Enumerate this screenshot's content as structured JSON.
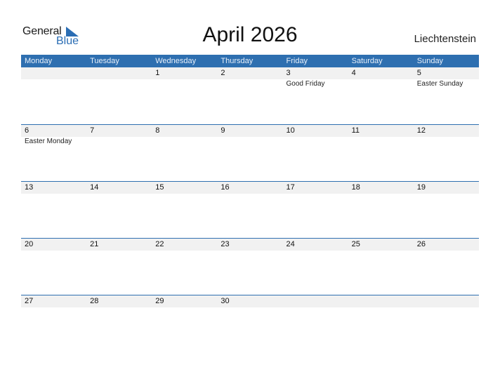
{
  "logo": {
    "general": "General",
    "blue": "Blue"
  },
  "title": "April 2026",
  "country": "Liechtenstein",
  "colors": {
    "accent": "#2e6fb0",
    "strip": "#f1f1f1"
  },
  "weekdays": [
    "Monday",
    "Tuesday",
    "Wednesday",
    "Thursday",
    "Friday",
    "Saturday",
    "Sunday"
  ],
  "weeks": [
    [
      {
        "d": ""
      },
      {
        "d": ""
      },
      {
        "d": "1"
      },
      {
        "d": "2"
      },
      {
        "d": "3",
        "h": "Good Friday"
      },
      {
        "d": "4"
      },
      {
        "d": "5",
        "h": "Easter Sunday"
      }
    ],
    [
      {
        "d": "6",
        "h": "Easter Monday"
      },
      {
        "d": "7"
      },
      {
        "d": "8"
      },
      {
        "d": "9"
      },
      {
        "d": "10"
      },
      {
        "d": "11"
      },
      {
        "d": "12"
      }
    ],
    [
      {
        "d": "13"
      },
      {
        "d": "14"
      },
      {
        "d": "15"
      },
      {
        "d": "16"
      },
      {
        "d": "17"
      },
      {
        "d": "18"
      },
      {
        "d": "19"
      }
    ],
    [
      {
        "d": "20"
      },
      {
        "d": "21"
      },
      {
        "d": "22"
      },
      {
        "d": "23"
      },
      {
        "d": "24"
      },
      {
        "d": "25"
      },
      {
        "d": "26"
      }
    ],
    [
      {
        "d": "27"
      },
      {
        "d": "28"
      },
      {
        "d": "29"
      },
      {
        "d": "30"
      },
      {
        "d": ""
      },
      {
        "d": ""
      },
      {
        "d": ""
      }
    ]
  ]
}
